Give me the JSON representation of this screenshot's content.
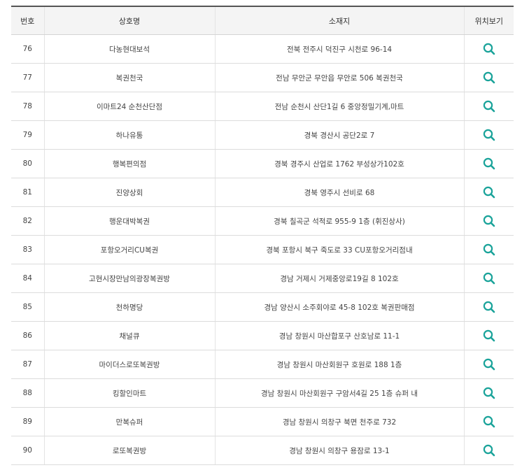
{
  "table": {
    "headers": {
      "no": "번호",
      "name": "상호명",
      "address": "소재지",
      "location": "위치보기"
    },
    "icon_color": "#1aa39a",
    "rows": [
      {
        "no": "76",
        "name": "다농현대보석",
        "address": "전북 전주시 덕진구 시천로 96-14",
        "icon": "search-icon"
      },
      {
        "no": "77",
        "name": "복권천국",
        "address": "전남 무안군 무안읍 무안로 506 복권천국",
        "icon": "search-icon"
      },
      {
        "no": "78",
        "name": "이마트24 순천산단점",
        "address": "전남 순천시 산단1길 6 중앙정밀기계,마트",
        "icon": "search-icon"
      },
      {
        "no": "79",
        "name": "하나유통",
        "address": "경북 경산시 공단2로 7",
        "icon": "search-icon"
      },
      {
        "no": "80",
        "name": "행복편의점",
        "address": "경북 경주시 산업로 1762 부성상가102호",
        "icon": "search-icon"
      },
      {
        "no": "81",
        "name": "진양상회",
        "address": "경북 영주시 선비로 68",
        "icon": "search-icon"
      },
      {
        "no": "82",
        "name": "행운대박복권",
        "address": "경북 칠곡군 석적로 955-9 1층 (휘진상사)",
        "icon": "search-icon"
      },
      {
        "no": "83",
        "name": "포항오거리CU복권",
        "address": "경북 포항시 북구 죽도로 33 CU포항오거리점내",
        "icon": "search-icon"
      },
      {
        "no": "84",
        "name": "고현시장만남의광장복권방",
        "address": "경남 거제시 거제중앙로19길 8 102호",
        "icon": "search-icon"
      },
      {
        "no": "85",
        "name": "천하명당",
        "address": "경남 양산시 소주회야로 45-8 102호 복권판매점",
        "icon": "search-icon"
      },
      {
        "no": "86",
        "name": "채널큐",
        "address": "경남 창원시 마산합포구 산호남로 11-1",
        "icon": "search-icon"
      },
      {
        "no": "87",
        "name": "마이더스로또복권방",
        "address": "경남 창원시 마산회원구 호원로 188 1층",
        "icon": "search-icon"
      },
      {
        "no": "88",
        "name": "킹할인마트",
        "address": "경남 창원시 마산회원구 구암서4길 25 1층 슈퍼 내",
        "icon": "search-icon"
      },
      {
        "no": "89",
        "name": "만복슈퍼",
        "address": "경남 창원시 의창구 북면 천주로 732",
        "icon": "search-icon"
      },
      {
        "no": "90",
        "name": "로또복권방",
        "address": "경남 창원시 의창구 용잠로 13-1",
        "icon": "search-icon"
      }
    ]
  }
}
